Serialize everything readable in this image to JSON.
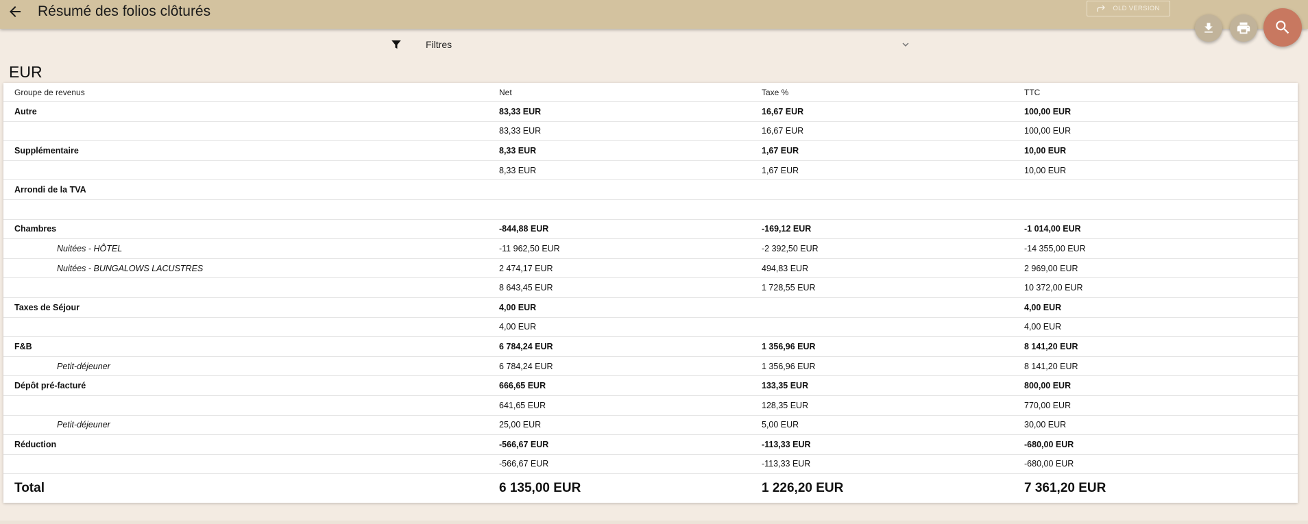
{
  "header": {
    "title": "Résumé des folios clôturés",
    "old_version_label": "OLD VERSION",
    "back_icon": "arrow-back-icon",
    "download_icon": "download-icon",
    "print_icon": "print-icon",
    "search_icon": "search-icon"
  },
  "filters": {
    "label": "Filtres",
    "icon": "filter-icon",
    "chevron": "chevron-down-icon"
  },
  "currency": "EUR",
  "table": {
    "columns": [
      "Groupe de revenus",
      "Net",
      "Taxe %",
      "TTC"
    ],
    "rows": [
      {
        "name": "Autre",
        "net": "83,33 EUR",
        "tax": "16,67 EUR",
        "ttc": "100,00 EUR",
        "style": "bold"
      },
      {
        "name": "",
        "net": "83,33 EUR",
        "tax": "16,67 EUR",
        "ttc": "100,00 EUR",
        "style": "normal"
      },
      {
        "name": "Supplémentaire",
        "net": "8,33 EUR",
        "tax": "1,67 EUR",
        "ttc": "10,00 EUR",
        "style": "bold"
      },
      {
        "name": "",
        "net": "8,33 EUR",
        "tax": "1,67 EUR",
        "ttc": "10,00 EUR",
        "style": "normal"
      },
      {
        "name": "Arrondi de la TVA",
        "net": "",
        "tax": "",
        "ttc": "",
        "style": "bold"
      },
      {
        "name": "",
        "net": "",
        "tax": "",
        "ttc": "",
        "style": "normal"
      },
      {
        "name": "Chambres",
        "net": "-844,88 EUR",
        "tax": "-169,12 EUR",
        "ttc": "-1 014,00 EUR",
        "style": "bold"
      },
      {
        "name": "Nuitées - HÔTEL",
        "net": "-11 962,50 EUR",
        "tax": "-2 392,50 EUR",
        "ttc": "-14 355,00 EUR",
        "style": "sub"
      },
      {
        "name": "Nuitées - BUNGALOWS LACUSTRES",
        "net": "2 474,17 EUR",
        "tax": "494,83 EUR",
        "ttc": "2 969,00 EUR",
        "style": "sub"
      },
      {
        "name": "",
        "net": "8 643,45 EUR",
        "tax": "1 728,55 EUR",
        "ttc": "10 372,00 EUR",
        "style": "normal"
      },
      {
        "name": "Taxes de Séjour",
        "net": "4,00 EUR",
        "tax": "",
        "ttc": "4,00 EUR",
        "style": "bold"
      },
      {
        "name": "",
        "net": "4,00 EUR",
        "tax": "",
        "ttc": "4,00 EUR",
        "style": "normal"
      },
      {
        "name": "F&B",
        "net": "6 784,24 EUR",
        "tax": "1 356,96 EUR",
        "ttc": "8 141,20 EUR",
        "style": "bold"
      },
      {
        "name": "Petit-déjeuner",
        "net": "6 784,24 EUR",
        "tax": "1 356,96 EUR",
        "ttc": "8 141,20 EUR",
        "style": "sub"
      },
      {
        "name": "Dépôt pré-facturé",
        "net": "666,65 EUR",
        "tax": "133,35 EUR",
        "ttc": "800,00 EUR",
        "style": "bold"
      },
      {
        "name": "",
        "net": "641,65 EUR",
        "tax": "128,35 EUR",
        "ttc": "770,00 EUR",
        "style": "normal"
      },
      {
        "name": "Petit-déjeuner",
        "net": "25,00 EUR",
        "tax": "5,00 EUR",
        "ttc": "30,00 EUR",
        "style": "sub"
      },
      {
        "name": "Réduction",
        "net": "-566,67 EUR",
        "tax": "-113,33 EUR",
        "ttc": "-680,00 EUR",
        "style": "bold"
      },
      {
        "name": "",
        "net": "-566,67 EUR",
        "tax": "-113,33 EUR",
        "ttc": "-680,00 EUR",
        "style": "normal"
      }
    ],
    "total": {
      "name": "Total",
      "net": "6 135,00 EUR",
      "tax": "1 226,20 EUR",
      "ttc": "7 361,20 EUR"
    }
  },
  "colors": {
    "topbar": "#d3c29f",
    "background": "#f3ebe2",
    "fab_search": "#c87860",
    "fab_small": "#c1b39a"
  }
}
